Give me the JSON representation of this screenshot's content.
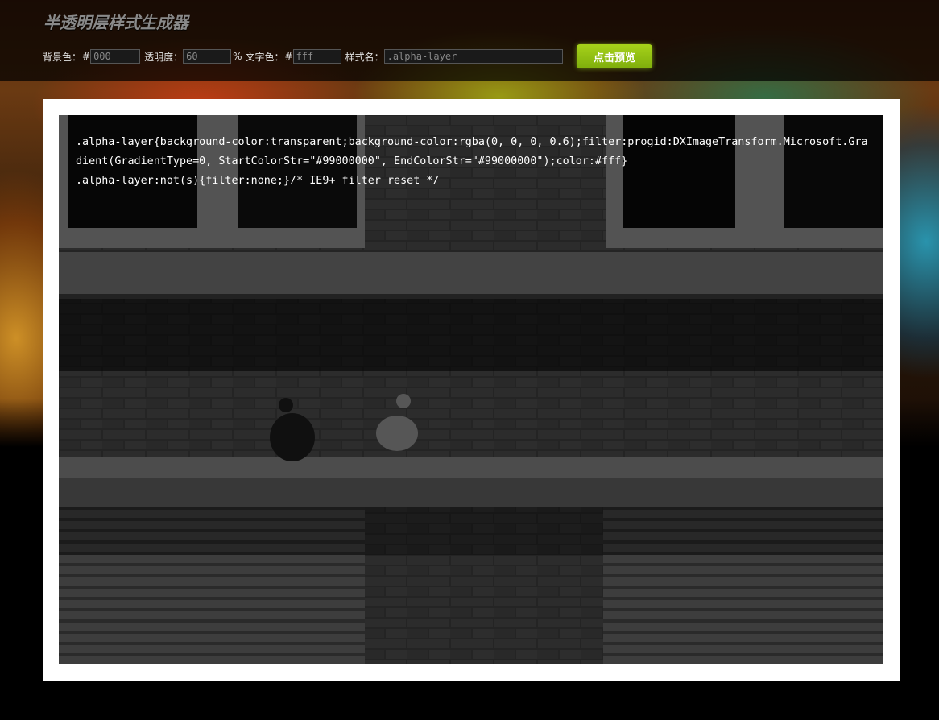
{
  "app": {
    "title": "半透明层样式生成器"
  },
  "form": {
    "bg_label": "背景色：",
    "bg_prefix": "#",
    "bg_value": "000",
    "alpha_label": "透明度：",
    "alpha_value": "60",
    "alpha_suffix": "%",
    "fc_label": "文字色：",
    "fc_prefix": "#",
    "fc_value": "fff",
    "name_label": "样式名：",
    "name_value": ".alpha-layer",
    "preview_button": "点击预览"
  },
  "preview": {
    "code_line1": ".alpha-layer{background-color:transparent;background-color:rgba(0, 0, 0, 0.6);filter:progid:DXImageTransform.Microsoft.Gradient(GradientType=0, StartColorStr=\"#99000000\", EndColorStr=\"#99000000\");color:#fff}",
    "code_line2": ".alpha-layer:not(s){filter:none;}/* IE9+ filter reset */"
  },
  "colors": {
    "accent_button": "#8fc012",
    "overlay": "rgba(0,0,0,0.6)",
    "text": "#ffffff"
  },
  "icons": []
}
